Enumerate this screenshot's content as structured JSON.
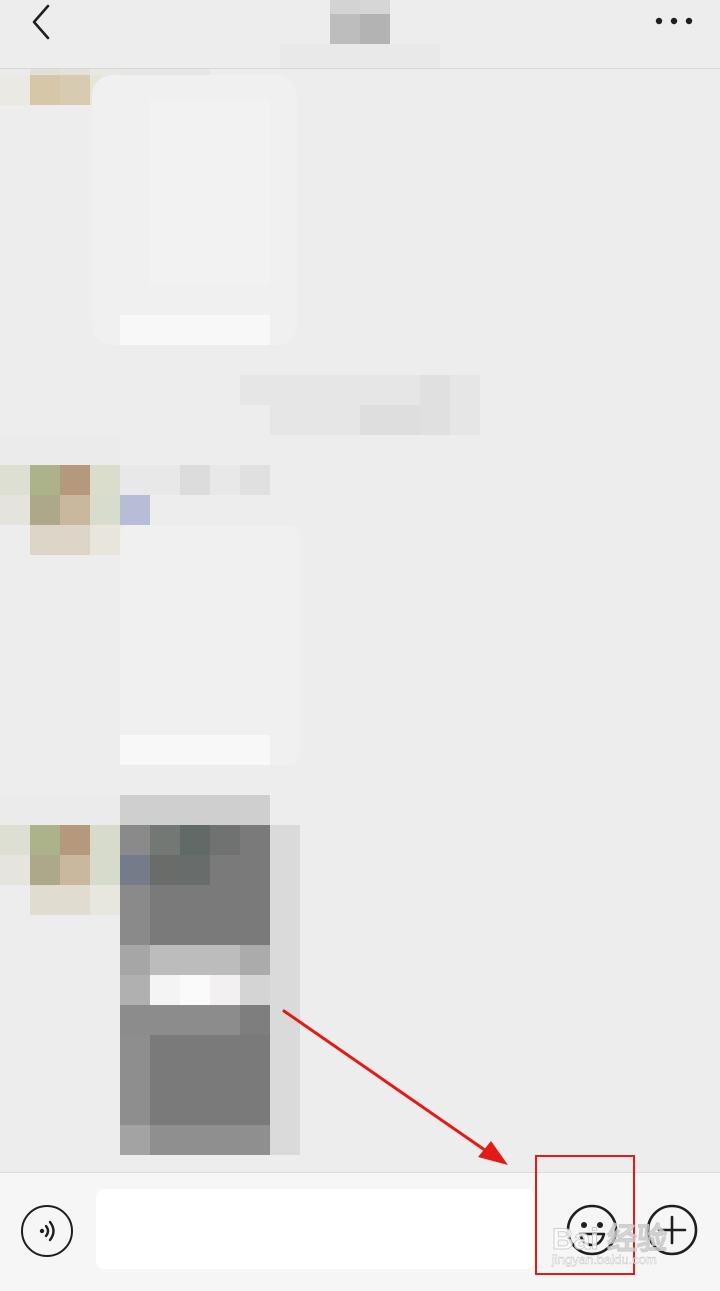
{
  "header": {
    "back_icon": "chevron-left-icon",
    "more_icon": "more-horizontal-icon",
    "title": ""
  },
  "input_bar": {
    "voice_icon": "voice-wave-icon",
    "message_value": "",
    "message_placeholder": "",
    "emoji_icon": "smiley-icon",
    "plus_icon": "plus-circle-icon"
  },
  "annotation": {
    "highlight_color": "#e31b16",
    "arrow_color": "#e31b16"
  },
  "watermark": {
    "main_text": "Bai 经验",
    "sub_text": "jingyan.baidu.com"
  },
  "colors": {
    "background": "#ededed",
    "input_bar": "#f6f6f6",
    "icon_stroke": "#1f1f1f"
  }
}
